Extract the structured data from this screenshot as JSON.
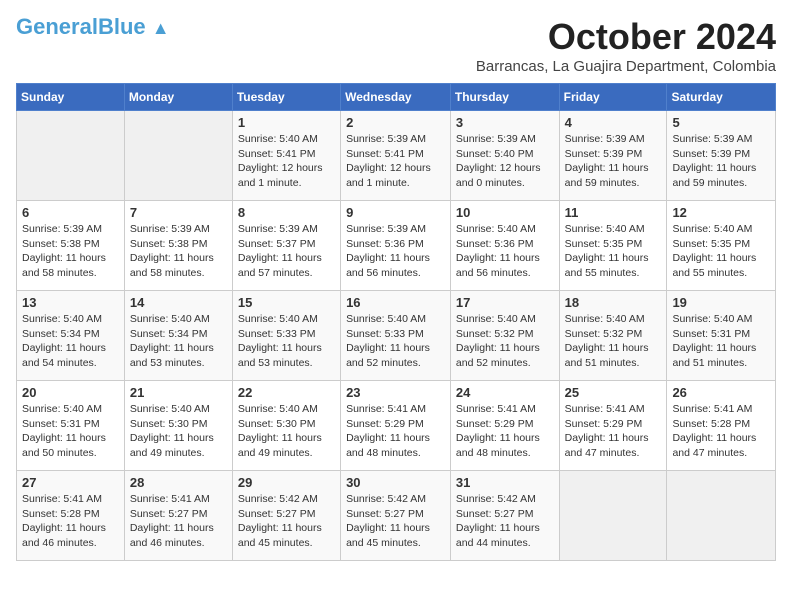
{
  "header": {
    "logo_general": "General",
    "logo_blue": "Blue",
    "month_title": "October 2024",
    "location": "Barrancas, La Guajira Department, Colombia"
  },
  "days_of_week": [
    "Sunday",
    "Monday",
    "Tuesday",
    "Wednesday",
    "Thursday",
    "Friday",
    "Saturday"
  ],
  "weeks": [
    [
      {
        "day": "",
        "content": ""
      },
      {
        "day": "",
        "content": ""
      },
      {
        "day": "1",
        "content": "Sunrise: 5:40 AM\nSunset: 5:41 PM\nDaylight: 12 hours and 1 minute."
      },
      {
        "day": "2",
        "content": "Sunrise: 5:39 AM\nSunset: 5:41 PM\nDaylight: 12 hours and 1 minute."
      },
      {
        "day": "3",
        "content": "Sunrise: 5:39 AM\nSunset: 5:40 PM\nDaylight: 12 hours and 0 minutes."
      },
      {
        "day": "4",
        "content": "Sunrise: 5:39 AM\nSunset: 5:39 PM\nDaylight: 11 hours and 59 minutes."
      },
      {
        "day": "5",
        "content": "Sunrise: 5:39 AM\nSunset: 5:39 PM\nDaylight: 11 hours and 59 minutes."
      }
    ],
    [
      {
        "day": "6",
        "content": "Sunrise: 5:39 AM\nSunset: 5:38 PM\nDaylight: 11 hours and 58 minutes."
      },
      {
        "day": "7",
        "content": "Sunrise: 5:39 AM\nSunset: 5:38 PM\nDaylight: 11 hours and 58 minutes."
      },
      {
        "day": "8",
        "content": "Sunrise: 5:39 AM\nSunset: 5:37 PM\nDaylight: 11 hours and 57 minutes."
      },
      {
        "day": "9",
        "content": "Sunrise: 5:39 AM\nSunset: 5:36 PM\nDaylight: 11 hours and 56 minutes."
      },
      {
        "day": "10",
        "content": "Sunrise: 5:40 AM\nSunset: 5:36 PM\nDaylight: 11 hours and 56 minutes."
      },
      {
        "day": "11",
        "content": "Sunrise: 5:40 AM\nSunset: 5:35 PM\nDaylight: 11 hours and 55 minutes."
      },
      {
        "day": "12",
        "content": "Sunrise: 5:40 AM\nSunset: 5:35 PM\nDaylight: 11 hours and 55 minutes."
      }
    ],
    [
      {
        "day": "13",
        "content": "Sunrise: 5:40 AM\nSunset: 5:34 PM\nDaylight: 11 hours and 54 minutes."
      },
      {
        "day": "14",
        "content": "Sunrise: 5:40 AM\nSunset: 5:34 PM\nDaylight: 11 hours and 53 minutes."
      },
      {
        "day": "15",
        "content": "Sunrise: 5:40 AM\nSunset: 5:33 PM\nDaylight: 11 hours and 53 minutes."
      },
      {
        "day": "16",
        "content": "Sunrise: 5:40 AM\nSunset: 5:33 PM\nDaylight: 11 hours and 52 minutes."
      },
      {
        "day": "17",
        "content": "Sunrise: 5:40 AM\nSunset: 5:32 PM\nDaylight: 11 hours and 52 minutes."
      },
      {
        "day": "18",
        "content": "Sunrise: 5:40 AM\nSunset: 5:32 PM\nDaylight: 11 hours and 51 minutes."
      },
      {
        "day": "19",
        "content": "Sunrise: 5:40 AM\nSunset: 5:31 PM\nDaylight: 11 hours and 51 minutes."
      }
    ],
    [
      {
        "day": "20",
        "content": "Sunrise: 5:40 AM\nSunset: 5:31 PM\nDaylight: 11 hours and 50 minutes."
      },
      {
        "day": "21",
        "content": "Sunrise: 5:40 AM\nSunset: 5:30 PM\nDaylight: 11 hours and 49 minutes."
      },
      {
        "day": "22",
        "content": "Sunrise: 5:40 AM\nSunset: 5:30 PM\nDaylight: 11 hours and 49 minutes."
      },
      {
        "day": "23",
        "content": "Sunrise: 5:41 AM\nSunset: 5:29 PM\nDaylight: 11 hours and 48 minutes."
      },
      {
        "day": "24",
        "content": "Sunrise: 5:41 AM\nSunset: 5:29 PM\nDaylight: 11 hours and 48 minutes."
      },
      {
        "day": "25",
        "content": "Sunrise: 5:41 AM\nSunset: 5:29 PM\nDaylight: 11 hours and 47 minutes."
      },
      {
        "day": "26",
        "content": "Sunrise: 5:41 AM\nSunset: 5:28 PM\nDaylight: 11 hours and 47 minutes."
      }
    ],
    [
      {
        "day": "27",
        "content": "Sunrise: 5:41 AM\nSunset: 5:28 PM\nDaylight: 11 hours and 46 minutes."
      },
      {
        "day": "28",
        "content": "Sunrise: 5:41 AM\nSunset: 5:27 PM\nDaylight: 11 hours and 46 minutes."
      },
      {
        "day": "29",
        "content": "Sunrise: 5:42 AM\nSunset: 5:27 PM\nDaylight: 11 hours and 45 minutes."
      },
      {
        "day": "30",
        "content": "Sunrise: 5:42 AM\nSunset: 5:27 PM\nDaylight: 11 hours and 45 minutes."
      },
      {
        "day": "31",
        "content": "Sunrise: 5:42 AM\nSunset: 5:27 PM\nDaylight: 11 hours and 44 minutes."
      },
      {
        "day": "",
        "content": ""
      },
      {
        "day": "",
        "content": ""
      }
    ]
  ]
}
